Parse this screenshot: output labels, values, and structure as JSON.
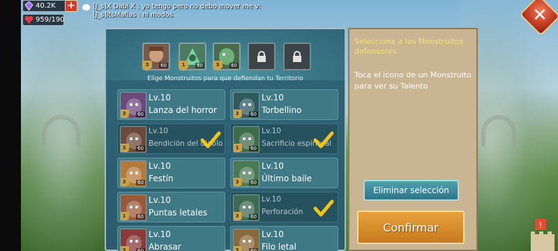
{
  "hud": {
    "gems": "40.2K",
    "stamina": "959/190",
    "add_label": "+"
  },
  "chat": {
    "line1": "[J_s]X Dabi X : yo tengo pero no debo mover me  v:",
    "line2": "[J_s]itsMafias : ni modos"
  },
  "close_label": "✕",
  "panel": {
    "instruction": "Elige Monstruitos para que defiendan tu Territorio",
    "slots": [
      {
        "level": "60",
        "shield": "3"
      },
      {
        "level": "60",
        "shield": "1"
      },
      {
        "level": "60",
        "shield": "3"
      }
    ],
    "cards": [
      {
        "lv": "Lv.10",
        "name": "Lanza del horror",
        "selected": false,
        "level": "60",
        "shield": "3"
      },
      {
        "lv": "Lv.10",
        "name": "Torbellino",
        "selected": false,
        "level": "60",
        "shield": "3"
      },
      {
        "lv": "Lv.10",
        "name": "Bendición del diablo",
        "selected": true,
        "level": "60",
        "shield": "3"
      },
      {
        "lv": "Lv.10",
        "name": "Sacrificio espiritual",
        "selected": true,
        "level": "60",
        "shield": "1"
      },
      {
        "lv": "Lv.10",
        "name": "Festín",
        "selected": false,
        "level": "60",
        "shield": "3"
      },
      {
        "lv": "Lv.10",
        "name": "Último baile",
        "selected": false,
        "level": "60",
        "shield": "3"
      },
      {
        "lv": "Lv.10",
        "name": "Puntas letales",
        "selected": false,
        "level": "60",
        "shield": "1"
      },
      {
        "lv": "Lv.10",
        "name": "Perforación",
        "selected": true,
        "level": "60",
        "shield": "3"
      },
      {
        "lv": "Lv.10",
        "name": "Abrasar",
        "selected": false,
        "level": "60",
        "shield": "3"
      },
      {
        "lv": "Lv.10",
        "name": "Filo letal",
        "selected": false,
        "level": "60",
        "shield": "3"
      }
    ]
  },
  "info": {
    "title": "Selecciona a los Monstruitos defensores",
    "body": "Toca el icono de un Monstruito para ver su Talento"
  },
  "buttons": {
    "clear": "Eliminar selección",
    "confirm": "Confirmar"
  },
  "colors": {
    "panel": "#2f6578",
    "card": "#3f7986",
    "card_selected": "#25525e",
    "info_bg": "#c9b592",
    "title_yellow": "#f6e26c",
    "confirm": "#d98c28",
    "check": "#f2c318"
  },
  "icons": {
    "gem": "gem-icon",
    "heart": "heart-icon",
    "chat": "chat-icon",
    "lock": "lock-icon",
    "check": "checkmark-icon"
  }
}
